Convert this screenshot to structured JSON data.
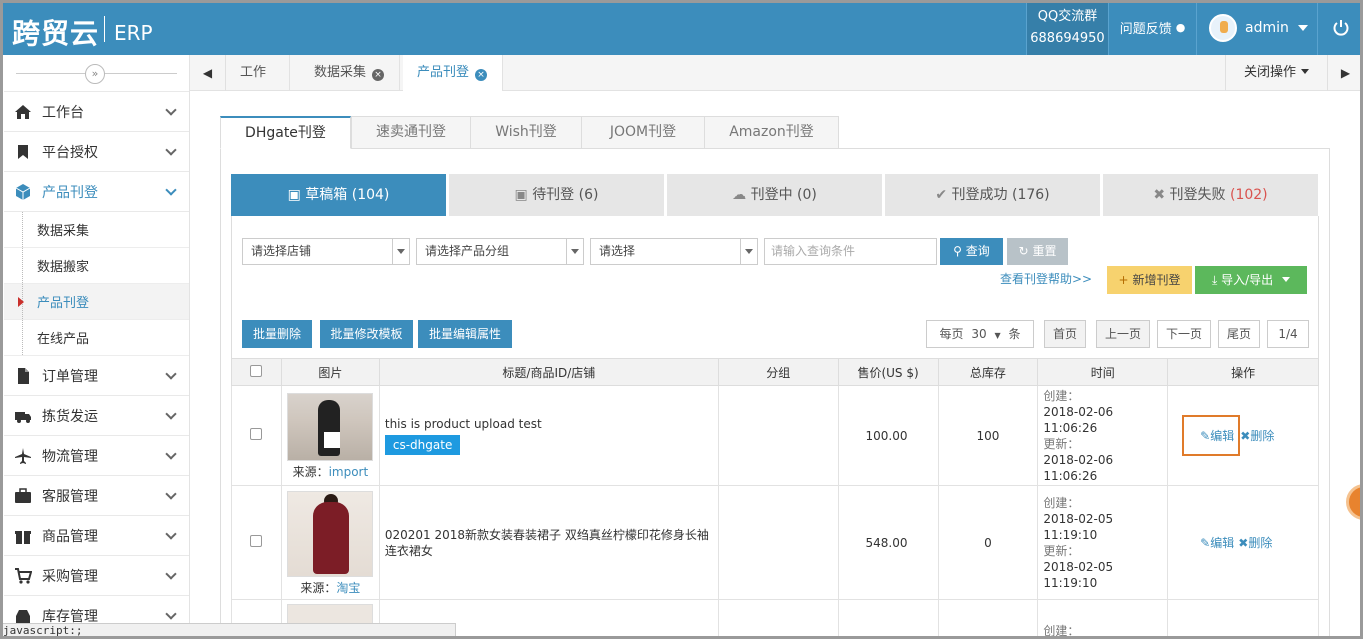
{
  "header": {
    "logo": "跨贸云",
    "erp": "ERP",
    "qq_label": "QQ交流群",
    "qq_number": "688694950",
    "feedback": "问题反馈",
    "user": "admin"
  },
  "sidebar": {
    "items": [
      {
        "label": "工作台"
      },
      {
        "label": "平台授权"
      },
      {
        "label": "产品刊登"
      },
      {
        "label": "订单管理"
      },
      {
        "label": "拣货发运"
      },
      {
        "label": "物流管理"
      },
      {
        "label": "客服管理"
      },
      {
        "label": "商品管理"
      },
      {
        "label": "采购管理"
      },
      {
        "label": "库存管理"
      }
    ],
    "sub_items": [
      {
        "label": "数据采集"
      },
      {
        "label": "数据搬家"
      },
      {
        "label": "产品刊登"
      },
      {
        "label": "在线产品"
      }
    ]
  },
  "page_tabs": [
    {
      "label": "工作台"
    },
    {
      "label": "数据采集"
    },
    {
      "label": "产品刊登"
    }
  ],
  "close_ops": "关闭操作",
  "platform_tabs": [
    {
      "label": "DHgate刊登"
    },
    {
      "label": "速卖通刊登"
    },
    {
      "label": "Wish刊登"
    },
    {
      "label": "JOOM刊登"
    },
    {
      "label": "Amazon刊登"
    }
  ],
  "status_tabs": [
    {
      "label": "草稿箱",
      "count": "(104)"
    },
    {
      "label": "待刊登",
      "count": "(6)"
    },
    {
      "label": "刊登中",
      "count": "(0)"
    },
    {
      "label": "刊登成功",
      "count": "(176)"
    },
    {
      "label": "刊登失败",
      "count": "(102)"
    }
  ],
  "filters": {
    "store_placeholder": "请选择店铺",
    "group_placeholder": "请选择产品分组",
    "select_placeholder": "请选择",
    "query_placeholder": "请输入查询条件",
    "search": "查询",
    "reset": "重置",
    "help": "查看刊登帮助>>",
    "add": "新增刊登",
    "import_export": "导入/导出"
  },
  "bulk": {
    "delete": "批量删除",
    "modify_template": "批量修改模板",
    "edit_attrs": "批量编辑属性"
  },
  "pager": {
    "per_page_label": "每页",
    "per_page_value": "30",
    "unit": "条",
    "first": "首页",
    "prev": "上一页",
    "next": "下一页",
    "last": "尾页",
    "page": "1/4"
  },
  "table": {
    "headers": [
      "图片",
      "标题/商品ID/店铺",
      "分组",
      "售价(US $)",
      "总库存",
      "时间",
      "操作"
    ],
    "source_label": "来源：",
    "created_label": "创建：",
    "updated_label": "更新：",
    "edit": "编辑",
    "delete": "删除",
    "rows": [
      {
        "source": "import",
        "title": "this is product upload test",
        "store": "cs-dhgate",
        "group": "",
        "price": "100.00",
        "stock": "100",
        "created": "2018-02-06 11:06:26",
        "updated": "2018-02-06 11:06:26"
      },
      {
        "source": "淘宝",
        "title": "020201 2018新款女装春装裙子 双绉真丝柠檬印花修身长袖连衣裙女",
        "store": "",
        "group": "",
        "price": "548.00",
        "stock": "0",
        "created": "2018-02-05 11:19:10",
        "updated": "2018-02-05 11:19:10"
      }
    ],
    "row3_created_label": "创建："
  },
  "statusbar": "javascript:;",
  "colors": {
    "brand": "#3c8dbc",
    "danger": "#d9534f",
    "highlight": "#e07b2a"
  }
}
